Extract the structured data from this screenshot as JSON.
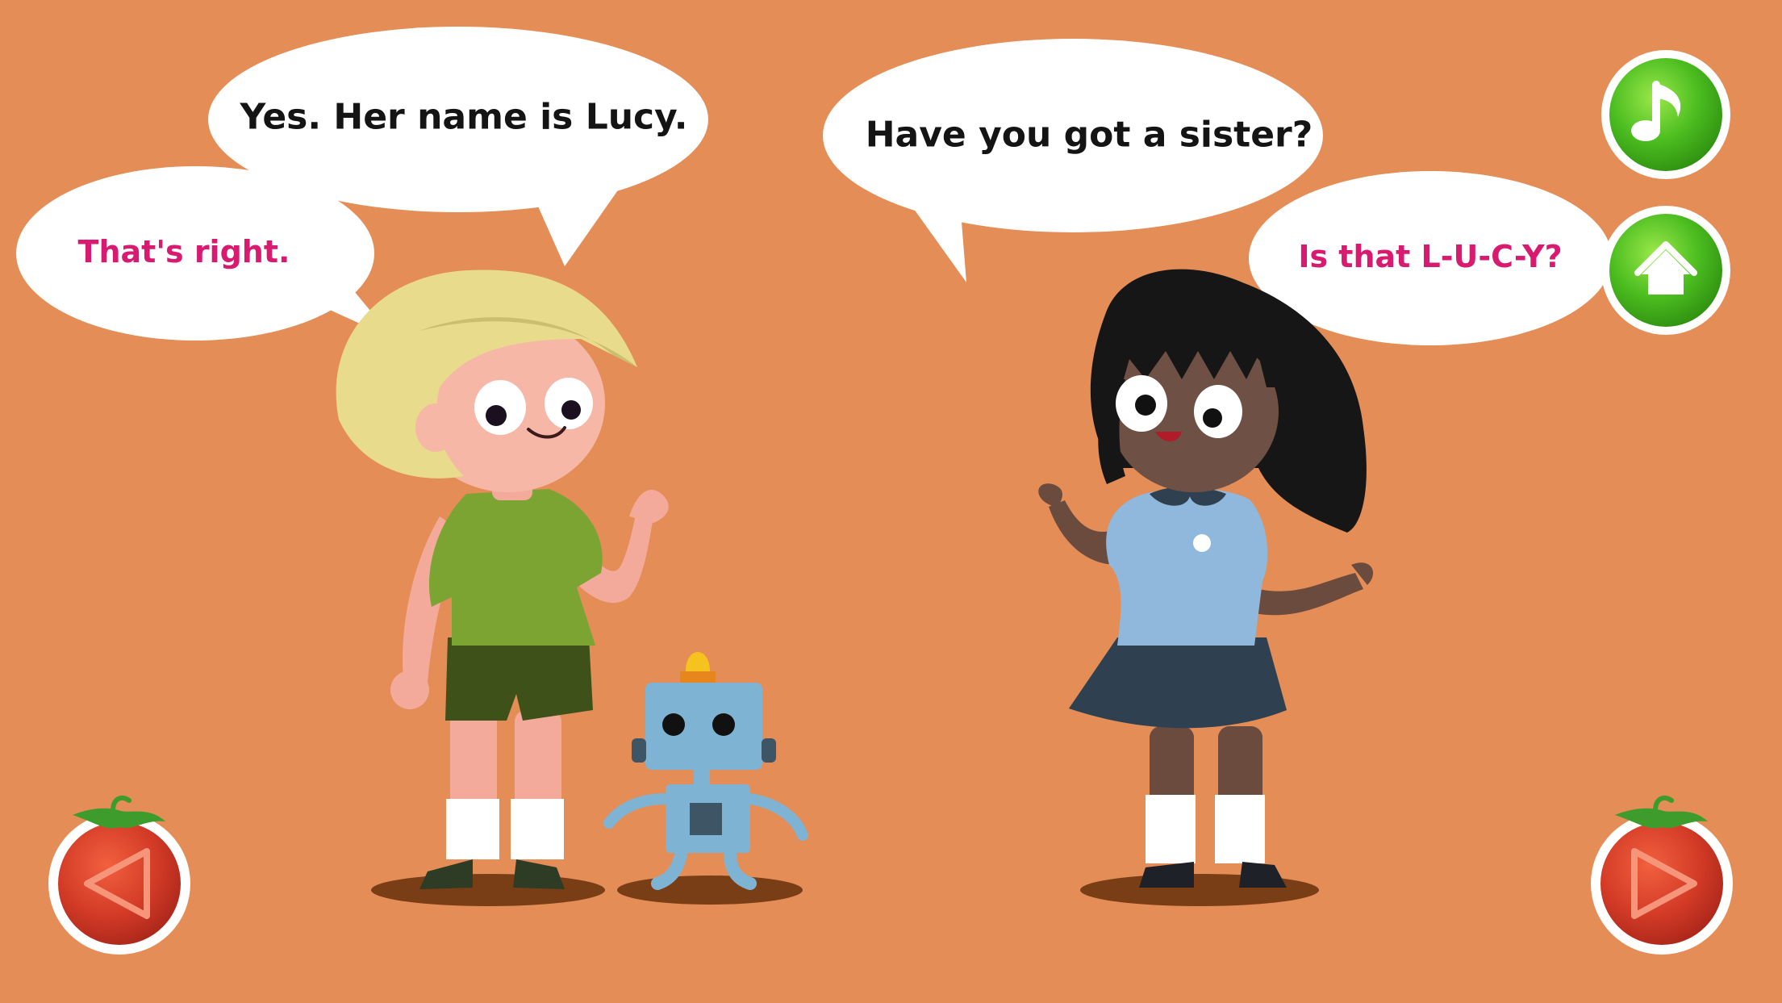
{
  "scene": {
    "background_color": "#e48d56",
    "characters": [
      "boy",
      "robot",
      "girl"
    ]
  },
  "bubbles": {
    "boy_main": "Yes. Her name is Lucy.",
    "boy_reply": "That's right.",
    "girl_main": "Have you got a sister?",
    "girl_reply": "Is that L-U-C-Y?"
  },
  "colors": {
    "main_text": "#141414",
    "reply_text": "#d81b71",
    "button_green": "#42b01b",
    "nav_red": "#d23a26"
  },
  "controls": {
    "music_button": {
      "icon": "music-note-icon"
    },
    "home_button": {
      "icon": "home-icon"
    },
    "prev_button": {
      "icon": "play-left-icon"
    },
    "next_button": {
      "icon": "play-right-icon"
    }
  }
}
